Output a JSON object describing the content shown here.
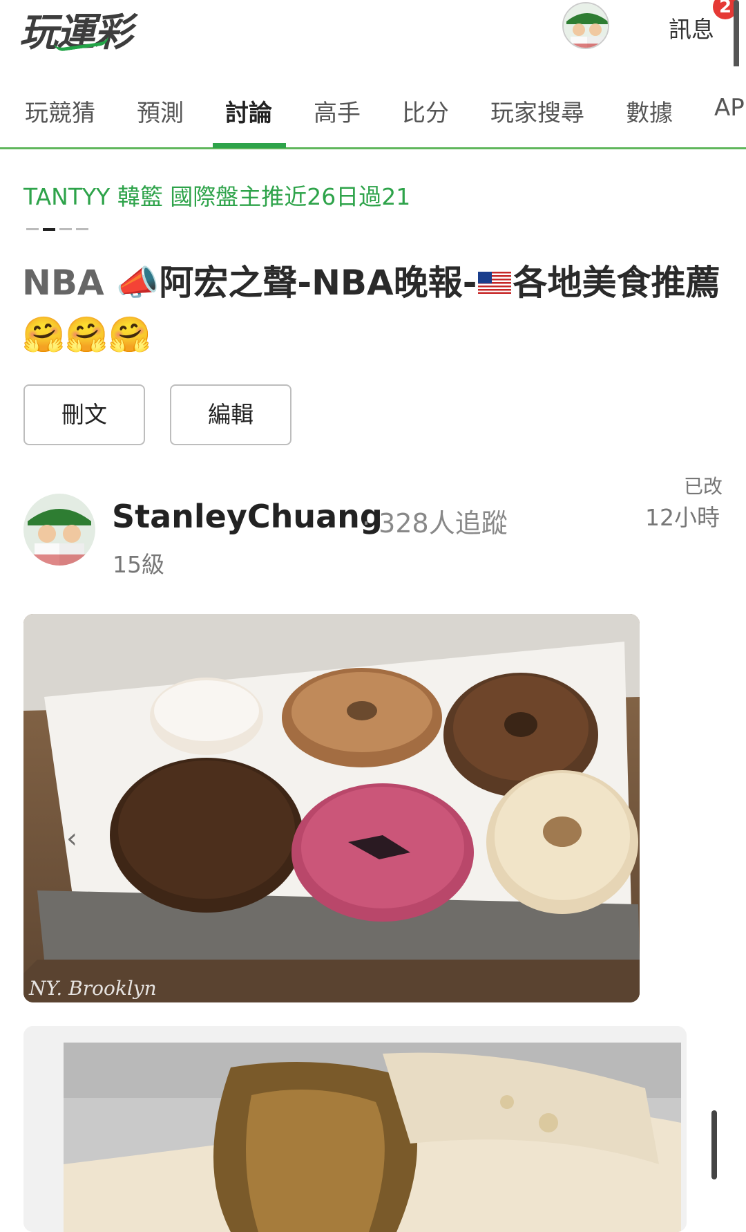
{
  "header": {
    "logo_text": "玩運彩",
    "messages_label": "訊息",
    "messages_badge": "2"
  },
  "nav": {
    "tabs": [
      {
        "label": "玩競猜"
      },
      {
        "label": "預測"
      },
      {
        "label": "討論",
        "active": true
      },
      {
        "label": "高手"
      },
      {
        "label": "比分"
      },
      {
        "label": "玩家搜尋"
      },
      {
        "label": "數據"
      },
      {
        "label": "AP"
      }
    ]
  },
  "ticker": {
    "text": "TANTYY 韓籃 國際盤主推近26日過21"
  },
  "post": {
    "title_prefix": "NBA ",
    "title_emoji_megaphone": "📣",
    "title_main_1": "阿宏之聲-NBA晚報-",
    "title_main_2": "各地美食推薦",
    "title_emoji_hug": "🤗🤗🤗",
    "delete_label": "刪文",
    "edit_label": "編輯"
  },
  "author": {
    "name": "StanleyChuang",
    "followers": "· 328人追蹤",
    "level": "15級",
    "edited_label": "已改",
    "time_ago": "12小時"
  },
  "images": {
    "photo1_caption": "NY. Brooklyn",
    "prev_arrow": "‹"
  },
  "colors": {
    "brand_green": "#2ea34a",
    "badge_red": "#e53935"
  },
  "icons": {
    "avatar": "avatar-icon",
    "flag": "us-flag-icon"
  }
}
